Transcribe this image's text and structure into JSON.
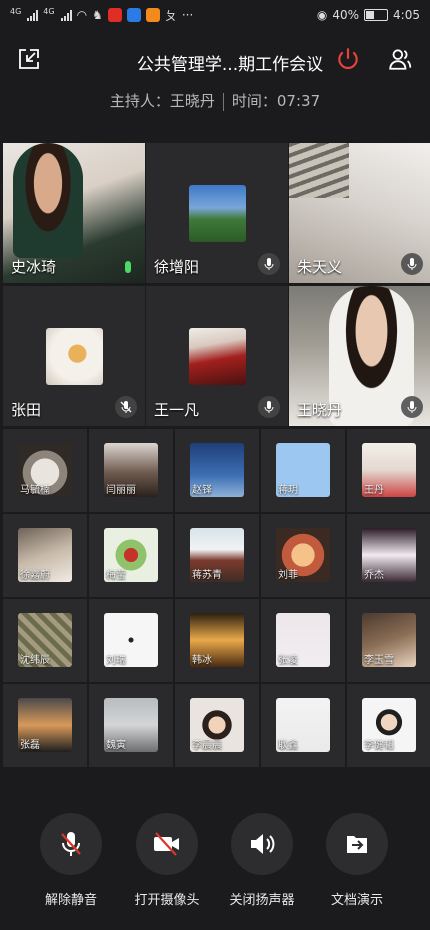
{
  "status": {
    "network_tag_1": "4G",
    "network_tag_2": "4G",
    "battery": "40%",
    "time": "4:05",
    "battery_level": 0.4
  },
  "header": {
    "title": "公共管理学...期工作会议",
    "host_label": "主持人：王晓丹",
    "time_label": "时间：07:37"
  },
  "video_participants": [
    {
      "name": "史冰琦",
      "mic": "on"
    },
    {
      "name": "徐增阳",
      "mic": "on"
    },
    {
      "name": "朱天义",
      "mic": "on"
    },
    {
      "name": "张田",
      "mic": "muted"
    },
    {
      "name": "王一凡",
      "mic": "on"
    },
    {
      "name": "王晓丹",
      "mic": "on"
    }
  ],
  "participants": [
    {
      "name": "马毓楠"
    },
    {
      "name": "闫丽丽"
    },
    {
      "name": "赵铎"
    },
    {
      "name": "蒋玥"
    },
    {
      "name": "王丹"
    },
    {
      "name": "徐嘉蔚"
    },
    {
      "name": "梅莹"
    },
    {
      "name": "蒋苏青"
    },
    {
      "name": "刘菲"
    },
    {
      "name": "乔杰"
    },
    {
      "name": "沈纬辰"
    },
    {
      "name": "刘瑞"
    },
    {
      "name": "韩冰"
    },
    {
      "name": "张凌"
    },
    {
      "name": "李玉雪"
    },
    {
      "name": "张磊"
    },
    {
      "name": "魏寅"
    },
    {
      "name": "李晨晨"
    },
    {
      "name": "耿鑫"
    },
    {
      "name": "李健韬"
    }
  ],
  "controls": [
    {
      "label": "解除静音",
      "icon": "mic-off-icon"
    },
    {
      "label": "打开摄像头",
      "icon": "camera-off-icon"
    },
    {
      "label": "关闭扬声器",
      "icon": "speaker-icon"
    },
    {
      "label": "文档演示",
      "icon": "share-doc-icon"
    }
  ],
  "colors": {
    "background": "#1b1b1d",
    "end_meeting_red": "#e8423a",
    "mic_active_green": "#4cd964",
    "mute_red": "#d9372b"
  }
}
